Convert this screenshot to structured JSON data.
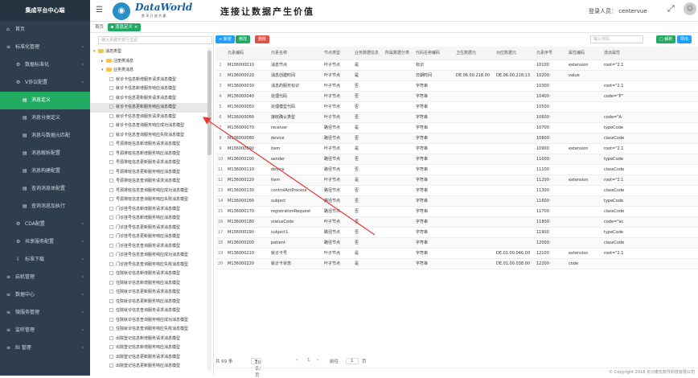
{
  "sidebar": {
    "title": "集成平台中心端",
    "items": [
      {
        "label": "首页",
        "icon": "home-icon",
        "level": 0
      },
      {
        "label": "标准化管理",
        "icon": "list-icon",
        "level": 0
      },
      {
        "label": "数据标准化",
        "icon": "gear-icon",
        "level": 1
      },
      {
        "label": "V协议配置",
        "icon": "gear-icon",
        "level": 1
      },
      {
        "label": "消息定义",
        "icon": "doc-icon",
        "level": 2,
        "active": true
      },
      {
        "label": "消息分类定义",
        "icon": "doc-icon",
        "level": 2
      },
      {
        "label": "消息与数据元匹配",
        "icon": "doc-icon",
        "level": 2
      },
      {
        "label": "消息解析配置",
        "icon": "doc-icon",
        "level": 2
      },
      {
        "label": "消息构建配置",
        "icon": "doc-icon",
        "level": 2
      },
      {
        "label": "查询消息体配置",
        "icon": "doc-icon",
        "level": 2
      },
      {
        "label": "查询消息加执行",
        "icon": "doc-icon",
        "level": 2
      },
      {
        "label": "CDA配置",
        "icon": "gear-icon",
        "level": 1
      },
      {
        "label": "共享服务配置",
        "icon": "gear-icon",
        "level": 1
      },
      {
        "label": "标准下载",
        "icon": "download-icon",
        "level": 1
      },
      {
        "label": "启机管理",
        "icon": "list-icon",
        "level": 0
      },
      {
        "label": "数据中心",
        "icon": "list-icon",
        "level": 0
      },
      {
        "label": "微服务管理",
        "icon": "list-icon",
        "level": 0
      },
      {
        "label": "监听管理",
        "icon": "list-icon",
        "level": 0
      },
      {
        "label": "BI 管理",
        "icon": "list-icon",
        "level": 0
      }
    ]
  },
  "header": {
    "logo_text": "DataWorld",
    "logo_sub": "数 享 开 放 共 赢",
    "slogan": "连接让数据产生价值",
    "login_label": "登录人员： centervue"
  },
  "tabs": {
    "home": "首页",
    "active": "消息定义"
  },
  "tree": {
    "search_placeholder": "输入关键字进行过滤",
    "nodes": [
      {
        "label": "消息类型",
        "level": 0,
        "type": "folder",
        "toggle": "▾"
      },
      {
        "label": "注册类消息",
        "level": 1,
        "type": "folder",
        "toggle": "▸"
      },
      {
        "label": "业务类消息",
        "level": 1,
        "type": "folder",
        "toggle": "▾"
      },
      {
        "label": "就诊卡信息新增服务请求消息模型",
        "level": 2,
        "type": "leaf"
      },
      {
        "label": "就诊卡信息新增服务响应消息模型",
        "level": 2,
        "type": "leaf"
      },
      {
        "label": "就诊卡信息更新服务请求消息模型",
        "level": 2,
        "type": "leaf"
      },
      {
        "label": "就诊卡信息更新服务响应消息模型",
        "level": 2,
        "type": "leaf",
        "selected": true
      },
      {
        "label": "就诊卡信息查询服务请求消息模型",
        "level": 2,
        "type": "leaf"
      },
      {
        "label": "就诊卡信息查询服务响应成功消息模型",
        "level": 2,
        "type": "leaf"
      },
      {
        "label": "就诊卡信息查询服务响应失败消息模型",
        "level": 2,
        "type": "leaf"
      },
      {
        "label": "号源排班信息新增服务请求消息模型",
        "level": 2,
        "type": "leaf"
      },
      {
        "label": "号源排班信息新增服务响应消息模型",
        "level": 2,
        "type": "leaf"
      },
      {
        "label": "号源排班信息更新服务请求消息模型",
        "level": 2,
        "type": "leaf"
      },
      {
        "label": "号源排班信息更新服务响应消息模型",
        "level": 2,
        "type": "leaf"
      },
      {
        "label": "号源排班信息查询服务请求消息模型",
        "level": 2,
        "type": "leaf"
      },
      {
        "label": "号源排班信息查询服务响应成功消息模型",
        "level": 2,
        "type": "leaf"
      },
      {
        "label": "号源排班信息查询服务响应失败消息模型",
        "level": 2,
        "type": "leaf"
      },
      {
        "label": "门诊挂号信息新增服务请求消息模型",
        "level": 2,
        "type": "leaf"
      },
      {
        "label": "门诊挂号信息新增服务响应消息模型",
        "level": 2,
        "type": "leaf"
      },
      {
        "label": "门诊挂号信息更新服务请求消息模型",
        "level": 2,
        "type": "leaf"
      },
      {
        "label": "门诊挂号信息更新服务响应消息模型",
        "level": 2,
        "type": "leaf"
      },
      {
        "label": "门诊挂号信息查询服务请求消息模型",
        "level": 2,
        "type": "leaf"
      },
      {
        "label": "门诊挂号信息查询服务响应成功消息模型",
        "level": 2,
        "type": "leaf"
      },
      {
        "label": "门诊挂号信息查询服务响应失败消息模型",
        "level": 2,
        "type": "leaf"
      },
      {
        "label": "住院就诊信息新增服务请求消息模型",
        "level": 2,
        "type": "leaf"
      },
      {
        "label": "住院就诊信息新增服务响应消息模型",
        "level": 2,
        "type": "leaf"
      },
      {
        "label": "住院就诊信息更新服务请求消息模型",
        "level": 2,
        "type": "leaf"
      },
      {
        "label": "住院就诊信息更新服务响应消息模型",
        "level": 2,
        "type": "leaf"
      },
      {
        "label": "住院就诊信息查询服务请求消息模型",
        "level": 2,
        "type": "leaf"
      },
      {
        "label": "住院就诊信息查询服务响应成功消息模型",
        "level": 2,
        "type": "leaf"
      },
      {
        "label": "住院就诊信息查询服务响应失败消息模型",
        "level": 2,
        "type": "leaf"
      },
      {
        "label": "出院登记信息新增服务请求消息模型",
        "level": 2,
        "type": "leaf"
      },
      {
        "label": "出院登记信息新增服务响应消息模型",
        "level": 2,
        "type": "leaf"
      },
      {
        "label": "出院登记信息更新服务请求消息模型",
        "level": 2,
        "type": "leaf"
      },
      {
        "label": "出院登记信息更新服务响应消息模型",
        "level": 2,
        "type": "leaf"
      }
    ]
  },
  "toolbar": {
    "add": "+ 新增",
    "edit": "修改",
    "delete": "删除",
    "code_placeholder": "输入代码",
    "check": "□ 解析",
    "export": "导出"
  },
  "table": {
    "columns": [
      "",
      "元素编码",
      "元素名称",
      "节点类型",
      "业务数据信息",
      "所属数据分类",
      "代码名称编码",
      "卫生数据元",
      "对应数据元",
      "元素序号",
      "属性编码",
      "流派属性"
    ],
    "rows": [
      [
        "1",
        "M136000010",
        "消息节点",
        "叶子节点",
        "是",
        "",
        "标识",
        "",
        "",
        "10100",
        "extension",
        "root=\"2.1"
      ],
      [
        "2",
        "M136000020",
        "消息创建时间",
        "叶子节点",
        "是",
        "",
        "日期时间",
        "DE.06.00.218.00",
        "DE.06.00.218.13",
        "10200",
        "value",
        ""
      ],
      [
        "3",
        "M136000030",
        "消息的服务标识",
        "叶子节点",
        "否",
        "",
        "字符串",
        "",
        "",
        "10300",
        "",
        "root=\"2.1"
      ],
      [
        "4",
        "M136000040",
        "处理代码",
        "叶子节点",
        "否",
        "",
        "字符串",
        "",
        "",
        "10400",
        "",
        "code=\"P\""
      ],
      [
        "5",
        "M136000050",
        "处理模型代码",
        "叶子节点",
        "否",
        "",
        "字符串",
        "",
        "",
        "10500",
        "",
        ""
      ],
      [
        "6",
        "M136000060",
        "接收确认类型",
        "叶子节点",
        "否",
        "",
        "字符串",
        "",
        "",
        "10600",
        "",
        "code=\"A"
      ],
      [
        "7",
        "M136000070",
        "receiver",
        "路径节点",
        "是",
        "",
        "字符串",
        "",
        "",
        "10700",
        "",
        "typeCode"
      ],
      [
        "8",
        "M136000080",
        "device",
        "路径节点",
        "否",
        "",
        "字符串",
        "",
        "",
        "10800",
        "",
        "classCode"
      ],
      [
        "9",
        "M136000090",
        "item",
        "叶子节点",
        "是",
        "",
        "字符串",
        "",
        "",
        "10900",
        "extension",
        "root=\"2.1"
      ],
      [
        "10",
        "M136000100",
        "sender",
        "路径节点",
        "否",
        "",
        "字符串",
        "",
        "",
        "11000",
        "",
        "typeCode"
      ],
      [
        "11",
        "M136000110",
        "device",
        "路径节点",
        "否",
        "",
        "字符串",
        "",
        "",
        "11100",
        "",
        "classCode"
      ],
      [
        "12",
        "M136000120",
        "item",
        "叶子节点",
        "是",
        "",
        "字符串",
        "",
        "",
        "11200",
        "extension",
        "root=\"2.1"
      ],
      [
        "13",
        "M136000130",
        "controlActProcess",
        "路径节点",
        "否",
        "",
        "字符串",
        "",
        "",
        "11300",
        "",
        "classCode"
      ],
      [
        "14",
        "M136000160",
        "subject",
        "路径节点",
        "否",
        "",
        "字符串",
        "",
        "",
        "11600",
        "",
        "typeCode"
      ],
      [
        "15",
        "M136000170",
        "registrationRequest",
        "路径节点",
        "否",
        "",
        "字符串",
        "",
        "",
        "11700",
        "",
        "classCode"
      ],
      [
        "16",
        "M136000180",
        "statusCode",
        "叶子节点",
        "否",
        "",
        "字符串",
        "",
        "",
        "11800",
        "",
        "code=\"ac"
      ],
      [
        "17",
        "M136000190",
        "subject1",
        "路径节点",
        "否",
        "",
        "字符串",
        "",
        "",
        "11900",
        "",
        "typeCode"
      ],
      [
        "18",
        "M136000200",
        "patient",
        "路径节点",
        "否",
        "",
        "字符串",
        "",
        "",
        "12000",
        "",
        "classCode"
      ],
      [
        "19",
        "M136000210",
        "就诊卡号",
        "叶子节点",
        "是",
        "",
        "字符串",
        "",
        "DE.01.00.046.00",
        "12100",
        "extension",
        "root=\"2.1"
      ],
      [
        "20",
        "M136000220",
        "就诊卡状态",
        "叶子节点",
        "是",
        "",
        "字符串",
        "",
        "DE.01.00.038.00",
        "12200",
        "code",
        ""
      ]
    ]
  },
  "pager": {
    "total": "共 69 条",
    "size": "20条/页",
    "prev": "‹",
    "current": "1",
    "next": "›",
    "goto": "前往",
    "page_input": "1",
    "page_suffix": "页"
  },
  "footer": {
    "copyright": "© Copyright 2018 长沙康氏软件科技有限公司"
  }
}
